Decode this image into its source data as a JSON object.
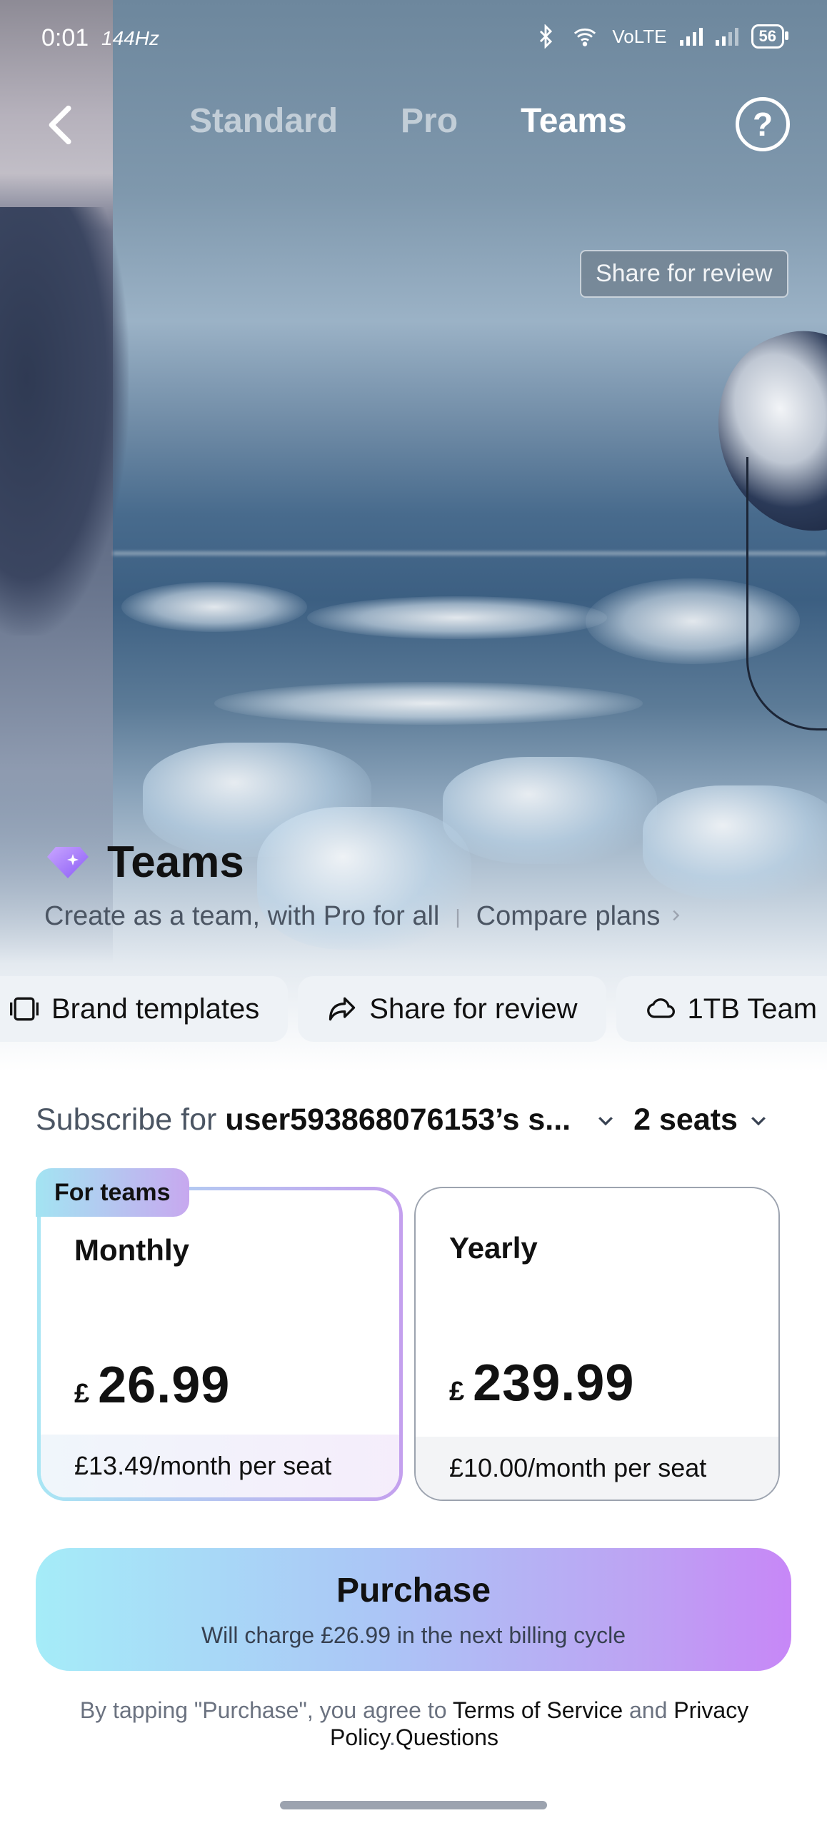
{
  "status_bar": {
    "time": "0:01",
    "refresh_rate": "144Hz",
    "network": "VoLTE",
    "battery": "56"
  },
  "nav": {
    "tabs": [
      {
        "label": "Standard",
        "active": false
      },
      {
        "label": "Pro",
        "active": false
      },
      {
        "label": "Teams",
        "active": true
      }
    ]
  },
  "hero": {
    "overlay_chip": "Share for review"
  },
  "plan": {
    "title": "Teams",
    "subtitle": "Create as a team, with Pro for all",
    "compare_link": "Compare plans"
  },
  "features": [
    {
      "label": "Brand templates",
      "icon": "brand-templates-icon"
    },
    {
      "label": "Share for review",
      "icon": "share-icon"
    },
    {
      "label": "1TB Team",
      "icon": "cloud-icon"
    }
  ],
  "subscribe": {
    "prefix": "Subscribe for",
    "team_name": "user593868076153’s s...",
    "seats": "2 seats"
  },
  "badge": "For teams",
  "cards": {
    "monthly": {
      "name": "Monthly",
      "currency": "£",
      "amount": "26.99",
      "per_seat": "£13.49/month per seat"
    },
    "yearly": {
      "name": "Yearly",
      "currency": "£",
      "amount": "239.99",
      "per_seat": "£10.00/month per seat"
    }
  },
  "purchase": {
    "label": "Purchase",
    "sub": "Will charge £26.99 in the next billing cycle"
  },
  "legal": {
    "prefix": "By tapping \"Purchase\", you agree to",
    "terms": "Terms of Service",
    "and": "and",
    "privacy": "Privacy Policy",
    "questions": "Questions"
  },
  "colors": {
    "accent_gradient_start": "#a5ecf8",
    "accent_gradient_end": "#c787f7"
  }
}
